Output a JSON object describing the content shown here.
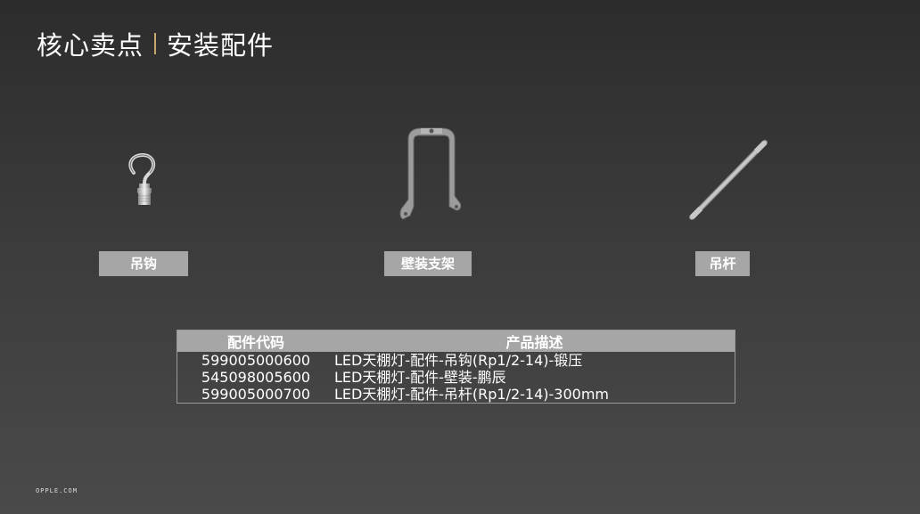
{
  "header": {
    "title_main": "核心卖点",
    "title_sub": "安装配件"
  },
  "products": [
    {
      "label": "吊钩"
    },
    {
      "label": "壁装支架"
    },
    {
      "label": "吊杆"
    }
  ],
  "table": {
    "headers": [
      "配件代码",
      "产品描述"
    ],
    "rows": [
      {
        "code": "599005000600",
        "desc": "LED天棚灯-配件-吊钩(Rp1/2-14)-锻压"
      },
      {
        "code": "545098005600",
        "desc": "LED天棚灯-配件-壁装-鹏辰"
      },
      {
        "code": "599005000700",
        "desc": "LED天棚灯-配件-吊杆(Rp1/2-14)-300mm"
      }
    ]
  },
  "footer": {
    "text": "OPPLE.COM"
  }
}
